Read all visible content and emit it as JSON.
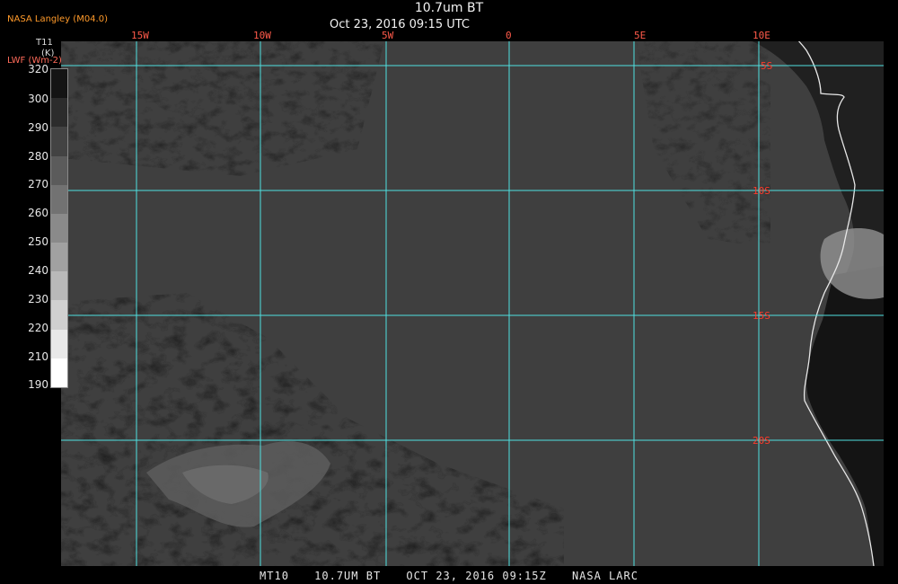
{
  "header": {
    "title": "10.7um BT",
    "subtitle": "Oct 23, 2016 09:15 UTC",
    "brand": "NASA Langley (M04.0)"
  },
  "colorbar": {
    "label_top": "T11",
    "label_unit": "(K)",
    "label_alt": "LWF (Wm-2)",
    "ticks": [
      "320",
      "300",
      "290",
      "280",
      "270",
      "260",
      "250",
      "240",
      "230",
      "220",
      "210",
      "190"
    ]
  },
  "grid": {
    "lon_labels": [
      "15W",
      "10W",
      "5W",
      "0",
      "5E",
      "10E"
    ],
    "lat_labels": [
      "5S",
      "10S",
      "15S",
      "20S"
    ],
    "line_color": "#4fe0e0"
  },
  "footer": {
    "product": "MT10",
    "channel": "10.7UM BT",
    "datetime": "OCT 23, 2016 09:15Z",
    "source": "NASA LARC"
  }
}
